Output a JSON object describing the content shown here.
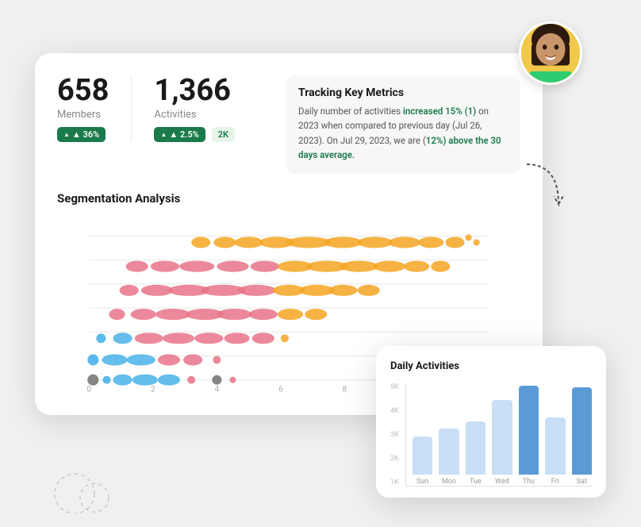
{
  "main_card": {
    "metric1": {
      "value": "658",
      "label": "Members",
      "badge": "▲ 36%"
    },
    "metric2": {
      "value": "1,366",
      "label": "Activities",
      "badge1": "▲ 2.5%",
      "badge2": "2K"
    },
    "tracking": {
      "title": "Tracking Key Metrics",
      "text_before": "Daily number of activities ",
      "highlight1": "increased 15% (1)",
      "text_mid": " on 2023 when compared to previous day (Jul 26, 2023). On Jul 29, 2023, we are (",
      "highlight2": "12%) above the 30 days average.",
      "text_end": ""
    },
    "segmentation_title": "Segmentation Analysis"
  },
  "daily_card": {
    "title": "Daily Activities",
    "y_labels": [
      "5K",
      "4K",
      "3K",
      "2K",
      "1K"
    ],
    "bars": [
      {
        "label": "Sun",
        "height_pct": 40,
        "highlighted": false
      },
      {
        "label": "Mon",
        "height_pct": 48,
        "highlighted": false
      },
      {
        "label": "Tue",
        "height_pct": 56,
        "highlighted": false
      },
      {
        "label": "Wed",
        "height_pct": 78,
        "highlighted": false
      },
      {
        "label": "Thu",
        "height_pct": 93,
        "highlighted": true
      },
      {
        "label": "Fri",
        "height_pct": 60,
        "highlighted": false
      },
      {
        "label": "Sat",
        "height_pct": 92,
        "highlighted": true
      }
    ]
  }
}
